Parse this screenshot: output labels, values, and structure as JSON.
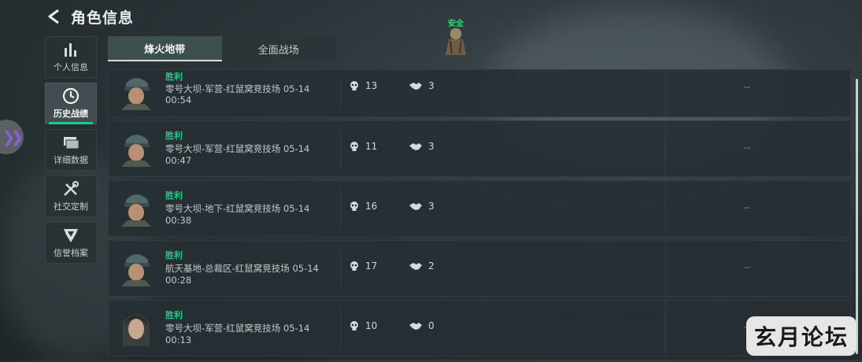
{
  "header": {
    "title": "角色信息"
  },
  "nav": [
    {
      "label": "个人信息",
      "icon": "bar-chart-icon"
    },
    {
      "label": "历史战绩",
      "icon": "clock-icon",
      "active": true
    },
    {
      "label": "详细数据",
      "icon": "folders-icon"
    },
    {
      "label": "社交定制",
      "icon": "tools-icon"
    },
    {
      "label": "信誉档案",
      "icon": "emblem-icon"
    }
  ],
  "tabs": [
    {
      "label": "烽火地带",
      "active": true
    },
    {
      "label": "全面战场",
      "active": false
    }
  ],
  "badge": {
    "label": "安全"
  },
  "matches": [
    {
      "result": "胜利",
      "map": "零号大坝-军营-红鼠窝竞技场 05-14",
      "duration": "00:54",
      "kills": "13",
      "assists": "3",
      "extra": "--"
    },
    {
      "result": "胜利",
      "map": "零号大坝-军营-红鼠窝竞技场 05-14",
      "duration": "00:47",
      "kills": "11",
      "assists": "3",
      "extra": "--"
    },
    {
      "result": "胜利",
      "map": "零号大坝-地下-红鼠窝竞技场 05-14",
      "duration": "00:38",
      "kills": "16",
      "assists": "3",
      "extra": "--"
    },
    {
      "result": "胜利",
      "map": "航天基地-总裁区-红鼠窝竞技场 05-14",
      "duration": "00:28",
      "kills": "17",
      "assists": "2",
      "extra": "--"
    },
    {
      "result": "胜利",
      "map": "零号大坝-军营-红鼠窝竞技场 05-14",
      "duration": "00:13",
      "kills": "10",
      "assists": "0",
      "extra": "--"
    }
  ],
  "watermark": "玄月论坛",
  "colors": {
    "accent": "#1ec989",
    "handle_arrow": "#8b5fd6"
  }
}
